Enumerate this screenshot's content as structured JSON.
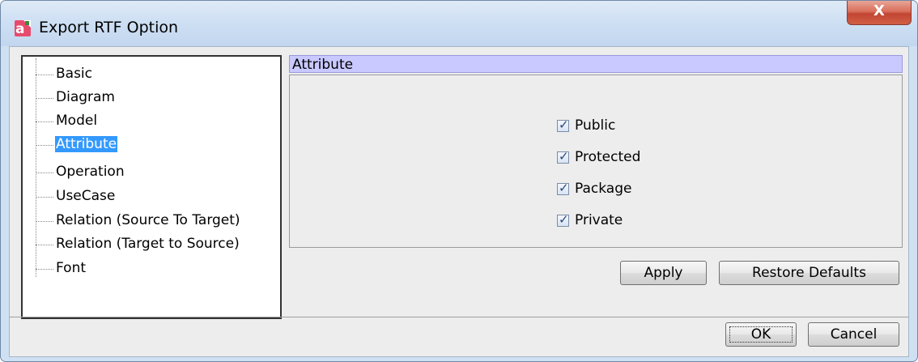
{
  "window": {
    "title": "Export RTF Option",
    "close_label": "X",
    "icon_name": "app-icon",
    "app_icon_text": "a"
  },
  "tree": {
    "items": [
      {
        "label": "Basic",
        "selected": false
      },
      {
        "label": "Diagram",
        "selected": false
      },
      {
        "label": "Model",
        "selected": false
      },
      {
        "label": "Attribute",
        "selected": true
      },
      {
        "label": "Operation",
        "selected": false
      },
      {
        "label": "UseCase",
        "selected": false
      },
      {
        "label": "Relation (Source To Target)",
        "selected": false
      },
      {
        "label": "Relation (Target to Source)",
        "selected": false
      },
      {
        "label": "Font",
        "selected": false
      }
    ]
  },
  "panel": {
    "header": "Attribute",
    "checkboxes": [
      {
        "label": "Public",
        "checked": true
      },
      {
        "label": "Protected",
        "checked": true
      },
      {
        "label": "Package",
        "checked": true
      },
      {
        "label": "Private",
        "checked": true
      }
    ],
    "apply_label": "Apply",
    "restore_label": "Restore Defaults"
  },
  "footer": {
    "ok_label": "OK",
    "cancel_label": "Cancel"
  },
  "colors": {
    "selection": "#3399ff",
    "panel_header_bg": "#c9c9ff",
    "close_button": "#c24633",
    "checkmark": "#27477d"
  }
}
